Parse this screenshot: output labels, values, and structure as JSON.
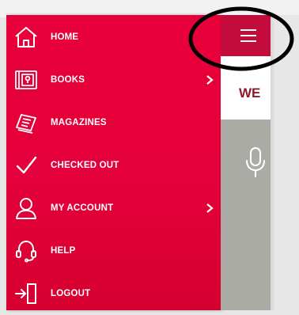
{
  "sidebar": {
    "items": [
      {
        "label": "HOME",
        "icon": "home-icon",
        "has_submenu": false
      },
      {
        "label": "BOOKS",
        "icon": "book-icon",
        "has_submenu": true
      },
      {
        "label": "MAGAZINES",
        "icon": "magazine-icon",
        "has_submenu": false
      },
      {
        "label": "CHECKED OUT",
        "icon": "checkmark-icon",
        "has_submenu": false
      },
      {
        "label": "MY ACCOUNT",
        "icon": "user-icon",
        "has_submenu": true
      },
      {
        "label": "HELP",
        "icon": "headset-icon",
        "has_submenu": false
      },
      {
        "label": "LOGOUT",
        "icon": "logout-icon",
        "has_submenu": false
      }
    ]
  },
  "header": {
    "menu_icon": "hamburger-menu-icon"
  },
  "content": {
    "heading_fragment": "WE",
    "search_icon": "microphone-icon"
  },
  "colors": {
    "sidebar_bg": "#e4003a",
    "menu_button_bg": "#c40c3c",
    "heading_color": "#8c1a2a",
    "content_gray": "#ababa5",
    "annotation_ring": "#000000"
  }
}
